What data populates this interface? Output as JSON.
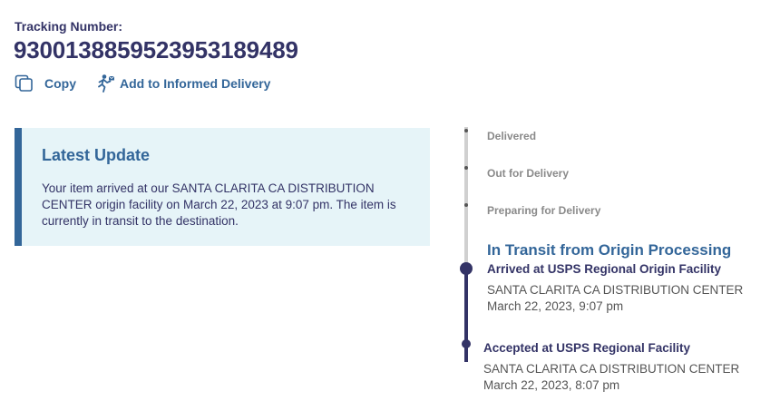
{
  "tracking": {
    "label": "Tracking Number:",
    "number": "9300138859523953189489"
  },
  "actions": {
    "copy": {
      "label": "Copy",
      "icon": "copy-icon"
    },
    "informed_delivery": {
      "label": "Add to Informed Delivery",
      "icon": "mail-carrier-icon"
    }
  },
  "latest_update": {
    "title": "Latest Update",
    "text": "Your item arrived at our SANTA CLARITA CA DISTRIBUTION CENTER origin facility on March 22, 2023 at 9:07 pm. The item is currently in transit to the destination."
  },
  "timeline": {
    "future_steps": [
      {
        "label": "Delivered"
      },
      {
        "label": "Out for Delivery"
      },
      {
        "label": "Preparing for Delivery"
      }
    ],
    "current_group": "In Transit from Origin Processing",
    "events": [
      {
        "title": "Arrived at USPS Regional Origin Facility",
        "location": "SANTA CLARITA CA DISTRIBUTION CENTER",
        "datetime": "March 22, 2023, 9:07 pm"
      },
      {
        "title": "Accepted at USPS Regional Facility",
        "location": "SANTA CLARITA CA DISTRIBUTION CENTER",
        "datetime": "March 22, 2023, 8:07 pm"
      }
    ]
  },
  "colors": {
    "navy": "#333366",
    "blue": "#336699",
    "update_bg": "#e6f4f8",
    "muted": "#8a8a8a",
    "line_grey": "#d0d0d0"
  }
}
